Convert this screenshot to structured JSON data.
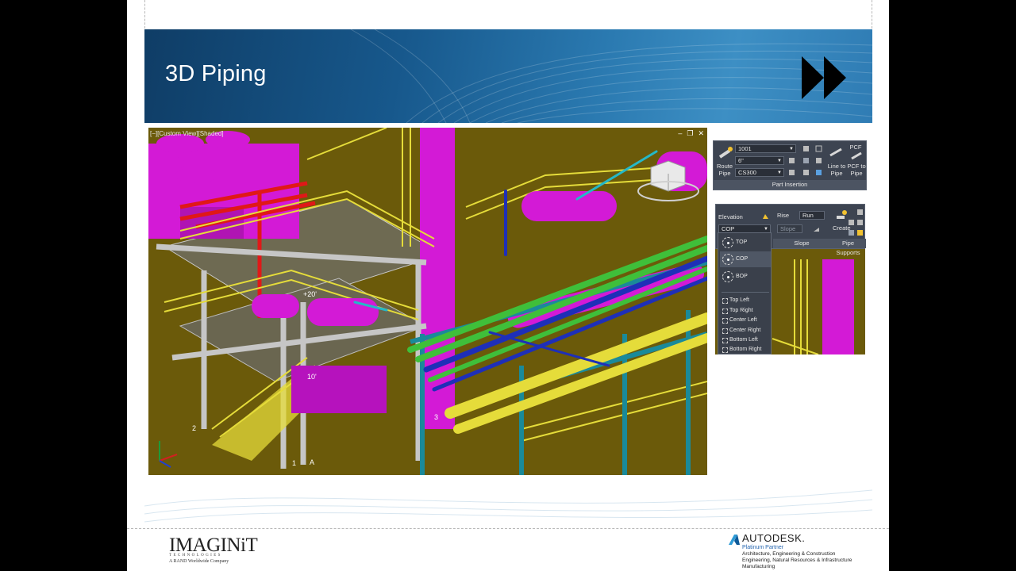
{
  "slide": {
    "title": "3D Piping",
    "nav_icon": "fast-forward-icon"
  },
  "viewport": {
    "label": "[−][Custom View][Shaded]",
    "controls": [
      "–",
      "❐",
      "✕"
    ],
    "annotations": [
      "+20'",
      "10'",
      "2",
      "1",
      "A",
      "3"
    ]
  },
  "part_insertion": {
    "route_pipe": "Route\nPipe",
    "size_value": "1001",
    "diameter_value": "6\"",
    "spec_value": "CS300",
    "line_to_pipe": "Line to\nPipe",
    "pcf_label": "PCF",
    "pcf_to_pipe": "PCF to\nPipe",
    "footer": "Part Insertion"
  },
  "elevation_panel": {
    "elevation_label": "Elevation",
    "selected_value": "COP",
    "rise_label": "Rise",
    "run_label": "Run",
    "slope_value": "Slope",
    "slope_footer": "Slope",
    "create_label": "Create",
    "supports_footer": "Pipe Supports"
  },
  "dropdown": {
    "items": [
      "TOP",
      "COP",
      "BOP"
    ],
    "small_items": [
      "Top Left",
      "Top Right",
      "Center Left",
      "Center Right",
      "Bottom Left",
      "Bottom Right"
    ]
  },
  "footer": {
    "imaginit": "IMAGINiT",
    "imaginit_sub": "TECHNOLOGIES",
    "imaginit_tag": "A RAND Worldwide Company",
    "autodesk": "AUTODESK.",
    "partner": "Platinum Partner",
    "lines": [
      "Architecture, Engineering & Construction",
      "Engineering, Natural Resources & Infrastructure",
      "Manufacturing"
    ]
  },
  "colors": {
    "banner": "#17588c",
    "viewport_bg": "#6b5a0a",
    "magenta": "#d31ad6",
    "yellow": "#e5dc3a",
    "teal": "#1a8a9a",
    "green": "#3fbf3a",
    "blue": "#1e2fb8"
  }
}
